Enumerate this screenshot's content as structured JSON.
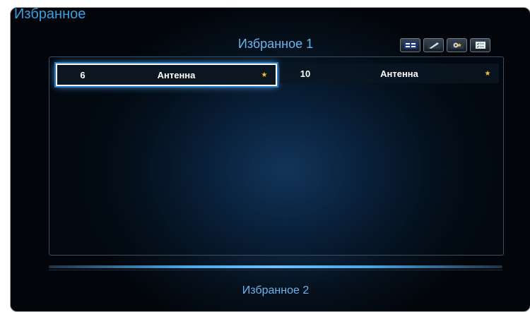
{
  "app": {
    "title": "Избранное"
  },
  "group1": {
    "title": "Избранное 1"
  },
  "group2": {
    "title": "Избранное 2"
  },
  "toolbar": {
    "icons": [
      "list-view-icon",
      "edit-icon",
      "settings-icon",
      "checklist-icon"
    ]
  },
  "channels": [
    {
      "number": "6",
      "name": "Антенна",
      "star": "★",
      "selected": true
    },
    {
      "number": "10",
      "name": "Антенна",
      "star": "★",
      "selected": false
    }
  ],
  "colors": {
    "accent": "#3a9fe0",
    "star": "#f1c234",
    "selection_glow": "#58b0ff"
  }
}
